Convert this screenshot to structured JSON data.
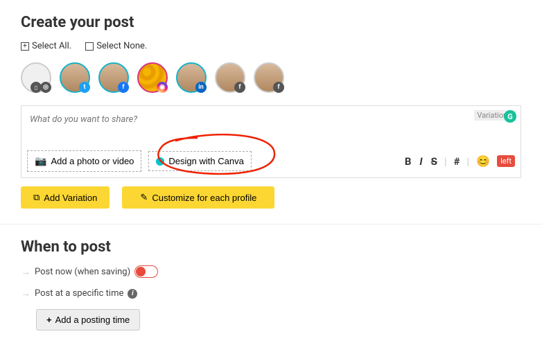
{
  "header": {
    "title": "Create your post",
    "select_all": "Select All.",
    "select_none": "Select None."
  },
  "avatars": [
    {
      "network": "multi"
    },
    {
      "network": "twitter"
    },
    {
      "network": "facebook"
    },
    {
      "network": "instagram"
    },
    {
      "network": "linkedin"
    },
    {
      "network": "facebook-page"
    },
    {
      "network": "other"
    }
  ],
  "composer": {
    "placeholder": "What do you want to share?",
    "variation_label": "Variation 1",
    "add_media": "Add a photo or video",
    "design_canva": "Design with Canva",
    "left_tag": "left"
  },
  "buttons": {
    "add_variation": "Add Variation",
    "customize": "Customize for each profile"
  },
  "schedule": {
    "title": "When to post",
    "post_now": "Post now (when saving)",
    "post_specific": "Post at a specific time",
    "add_time": "Add a posting time"
  }
}
